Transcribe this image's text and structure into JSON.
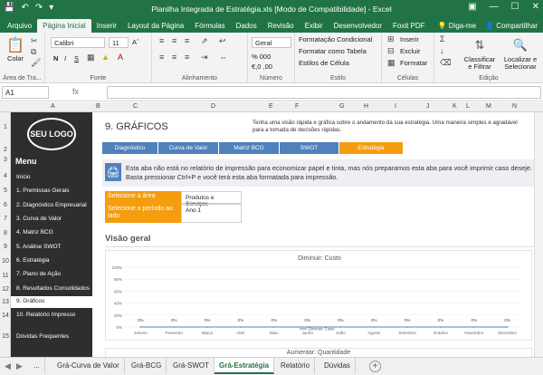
{
  "window": {
    "title": "Planilha Integrada de Estratégia.xls  [Modo de Compatibilidade] - Excel",
    "qat_icons": [
      "save-icon",
      "undo-icon",
      "redo-icon",
      "customize-icon"
    ],
    "win_icons": [
      "ribbon-options-icon",
      "minimize-icon",
      "maximize-icon",
      "close-icon"
    ]
  },
  "ribbon_tabs": [
    "Arquivo",
    "Página Inicial",
    "Inserir",
    "Layout da Página",
    "Fórmulas",
    "Dados",
    "Revisão",
    "Exibir",
    "Desenvolvedor",
    "Foxit PDF"
  ],
  "ribbon_right": {
    "tell_me": "Diga-me",
    "share": "Compartilhar"
  },
  "ribbon": {
    "clipboard": {
      "paste": "Colar",
      "label": "Área de Tra..."
    },
    "font": {
      "name": "Calibri",
      "size": "11",
      "label": "Fonte",
      "buttons": [
        "N",
        "I",
        "S"
      ]
    },
    "alignment": {
      "label": "Alinhamento"
    },
    "number": {
      "format": "Geral",
      "label": "Número",
      "items": [
        "% 000",
        "€,0 ,00"
      ]
    },
    "styles": {
      "items": [
        "Formatação Condicional",
        "Formatar como Tabela",
        "Estilos de Célula"
      ],
      "label": "Estilo"
    },
    "cells": {
      "items": [
        "Inserir",
        "Excluir",
        "Formatar"
      ],
      "label": "Células"
    },
    "editing": {
      "sort": "Classificar\ne Filtrar",
      "find": "Localizar e\nSelecionar",
      "label": "Edição"
    }
  },
  "formula_bar": {
    "name_box": "A1",
    "fx": "fx",
    "value": ""
  },
  "columns": [
    "A",
    "B",
    "C",
    "D",
    "E",
    "F",
    "G",
    "H",
    "I",
    "J",
    "K",
    "L",
    "M",
    "N"
  ],
  "rows": [
    "1",
    "2",
    "3",
    "4",
    "5",
    "6",
    "7",
    "8",
    "9",
    "10",
    "11",
    "12",
    "13",
    "14",
    "15"
  ],
  "sidebar": {
    "logo": "SEU LOGO",
    "menu_title": "Menu",
    "items": [
      "Início",
      "1. Premissas Gerais",
      "2. Diagnóstico Empresarial",
      "3. Curva de Valor",
      "4. Matriz BCG",
      "5. Análise SWOT",
      "6. Estratégia",
      "7. Plano de Ação",
      "8. Resultados Consolidados",
      "9. Gráficos",
      "10. Relatório Impresso",
      "Dúvidas Frequentes"
    ],
    "active_index": 9
  },
  "content": {
    "title": "9. GRÁFICOS",
    "description": "Tenha uma visão rápida e gráfica sobre o andamento da sua estratégia. Uma maneira simples e agradável para a tomada de decisões rápidas.",
    "nav_tabs": [
      "Diagnóstico",
      "Curva de Valor",
      "Matriz BCG",
      "SWOT",
      "Estratégia"
    ],
    "nav_active": 4,
    "info_text": "Esta aba não está no relatório de impressão para economizar papel e tinta, mas nós preparamos esta aba para você imprimir caso deseje. Basta pressionar Ctrl+P e você terá esta aba formatada para impressão.",
    "fields": [
      {
        "label": "Selecione a área",
        "value": "Produtos e Serviços"
      },
      {
        "label": "Selecione o período ao lado",
        "value": "Ano 1"
      }
    ],
    "section_title": "Visão geral",
    "next_chart_title": "Aumentar: Quantidade"
  },
  "chart_data": {
    "type": "line",
    "title": "Diminuir: Custo",
    "categories": [
      "Janeiro",
      "Fevereiro",
      "Março",
      "Abril",
      "Maio",
      "Junho",
      "Julho",
      "Agosto",
      "Setembro",
      "Outubro",
      "Novembro",
      "Dezembro"
    ],
    "series": [
      {
        "name": "Diminuir: Custo",
        "values": [
          0,
          0,
          0,
          0,
          0,
          0,
          0,
          0,
          0,
          0,
          0,
          0
        ]
      }
    ],
    "data_labels": [
      "0%",
      "0%",
      "0%",
      "0%",
      "0%",
      "0%",
      "0%",
      "0%",
      "0%",
      "0%",
      "0%",
      "0%"
    ],
    "y_ticks": [
      "100%",
      "80%",
      "60%",
      "40%",
      "20%",
      "0%"
    ],
    "ylim": [
      0,
      100
    ],
    "legend": "bottom-center",
    "color": "#4f81bd"
  },
  "sheet_tabs": [
    "...",
    "Grá-Curva de Valor",
    "Grá-BCG",
    "Grá-SWOT",
    "Grá-Estratégia",
    "Relatório",
    "Dúvidas"
  ],
  "sheet_active": 4
}
